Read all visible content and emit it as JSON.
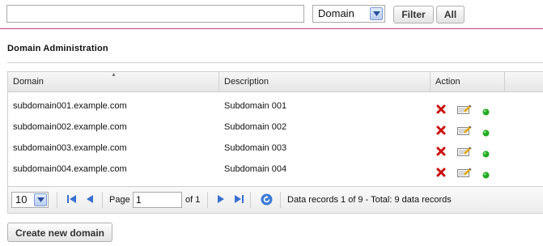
{
  "filter": {
    "search_value": "",
    "field_select_value": "Domain",
    "filter_label": "Filter",
    "all_label": "All"
  },
  "section": {
    "title": "Domain Administration"
  },
  "grid": {
    "columns": [
      "Domain",
      "Description",
      "Action"
    ],
    "sort_indicator": "▲",
    "rows": [
      {
        "domain": "subdomain001.example.com",
        "description": "Subdomain 001"
      },
      {
        "domain": "subdomain002.example.com",
        "description": "Subdomain 002"
      },
      {
        "domain": "subdomain003.example.com",
        "description": "Subdomain 003"
      },
      {
        "domain": "subdomain004.example.com",
        "description": "Subdomain 004"
      }
    ],
    "action_icons": [
      "delete-icon",
      "edit-icon",
      "status-icon"
    ]
  },
  "pager": {
    "page_size": "10",
    "page_label": "Page",
    "page_value": "1",
    "of_label": "of 1",
    "summary": "Data records 1 of 9 - Total: 9 data records"
  },
  "colors": {
    "accent_divider": "#c83b8c",
    "delete_red": "#cc1111",
    "status_green": "#22aa22"
  },
  "create_button": {
    "label": "Create new domain"
  }
}
